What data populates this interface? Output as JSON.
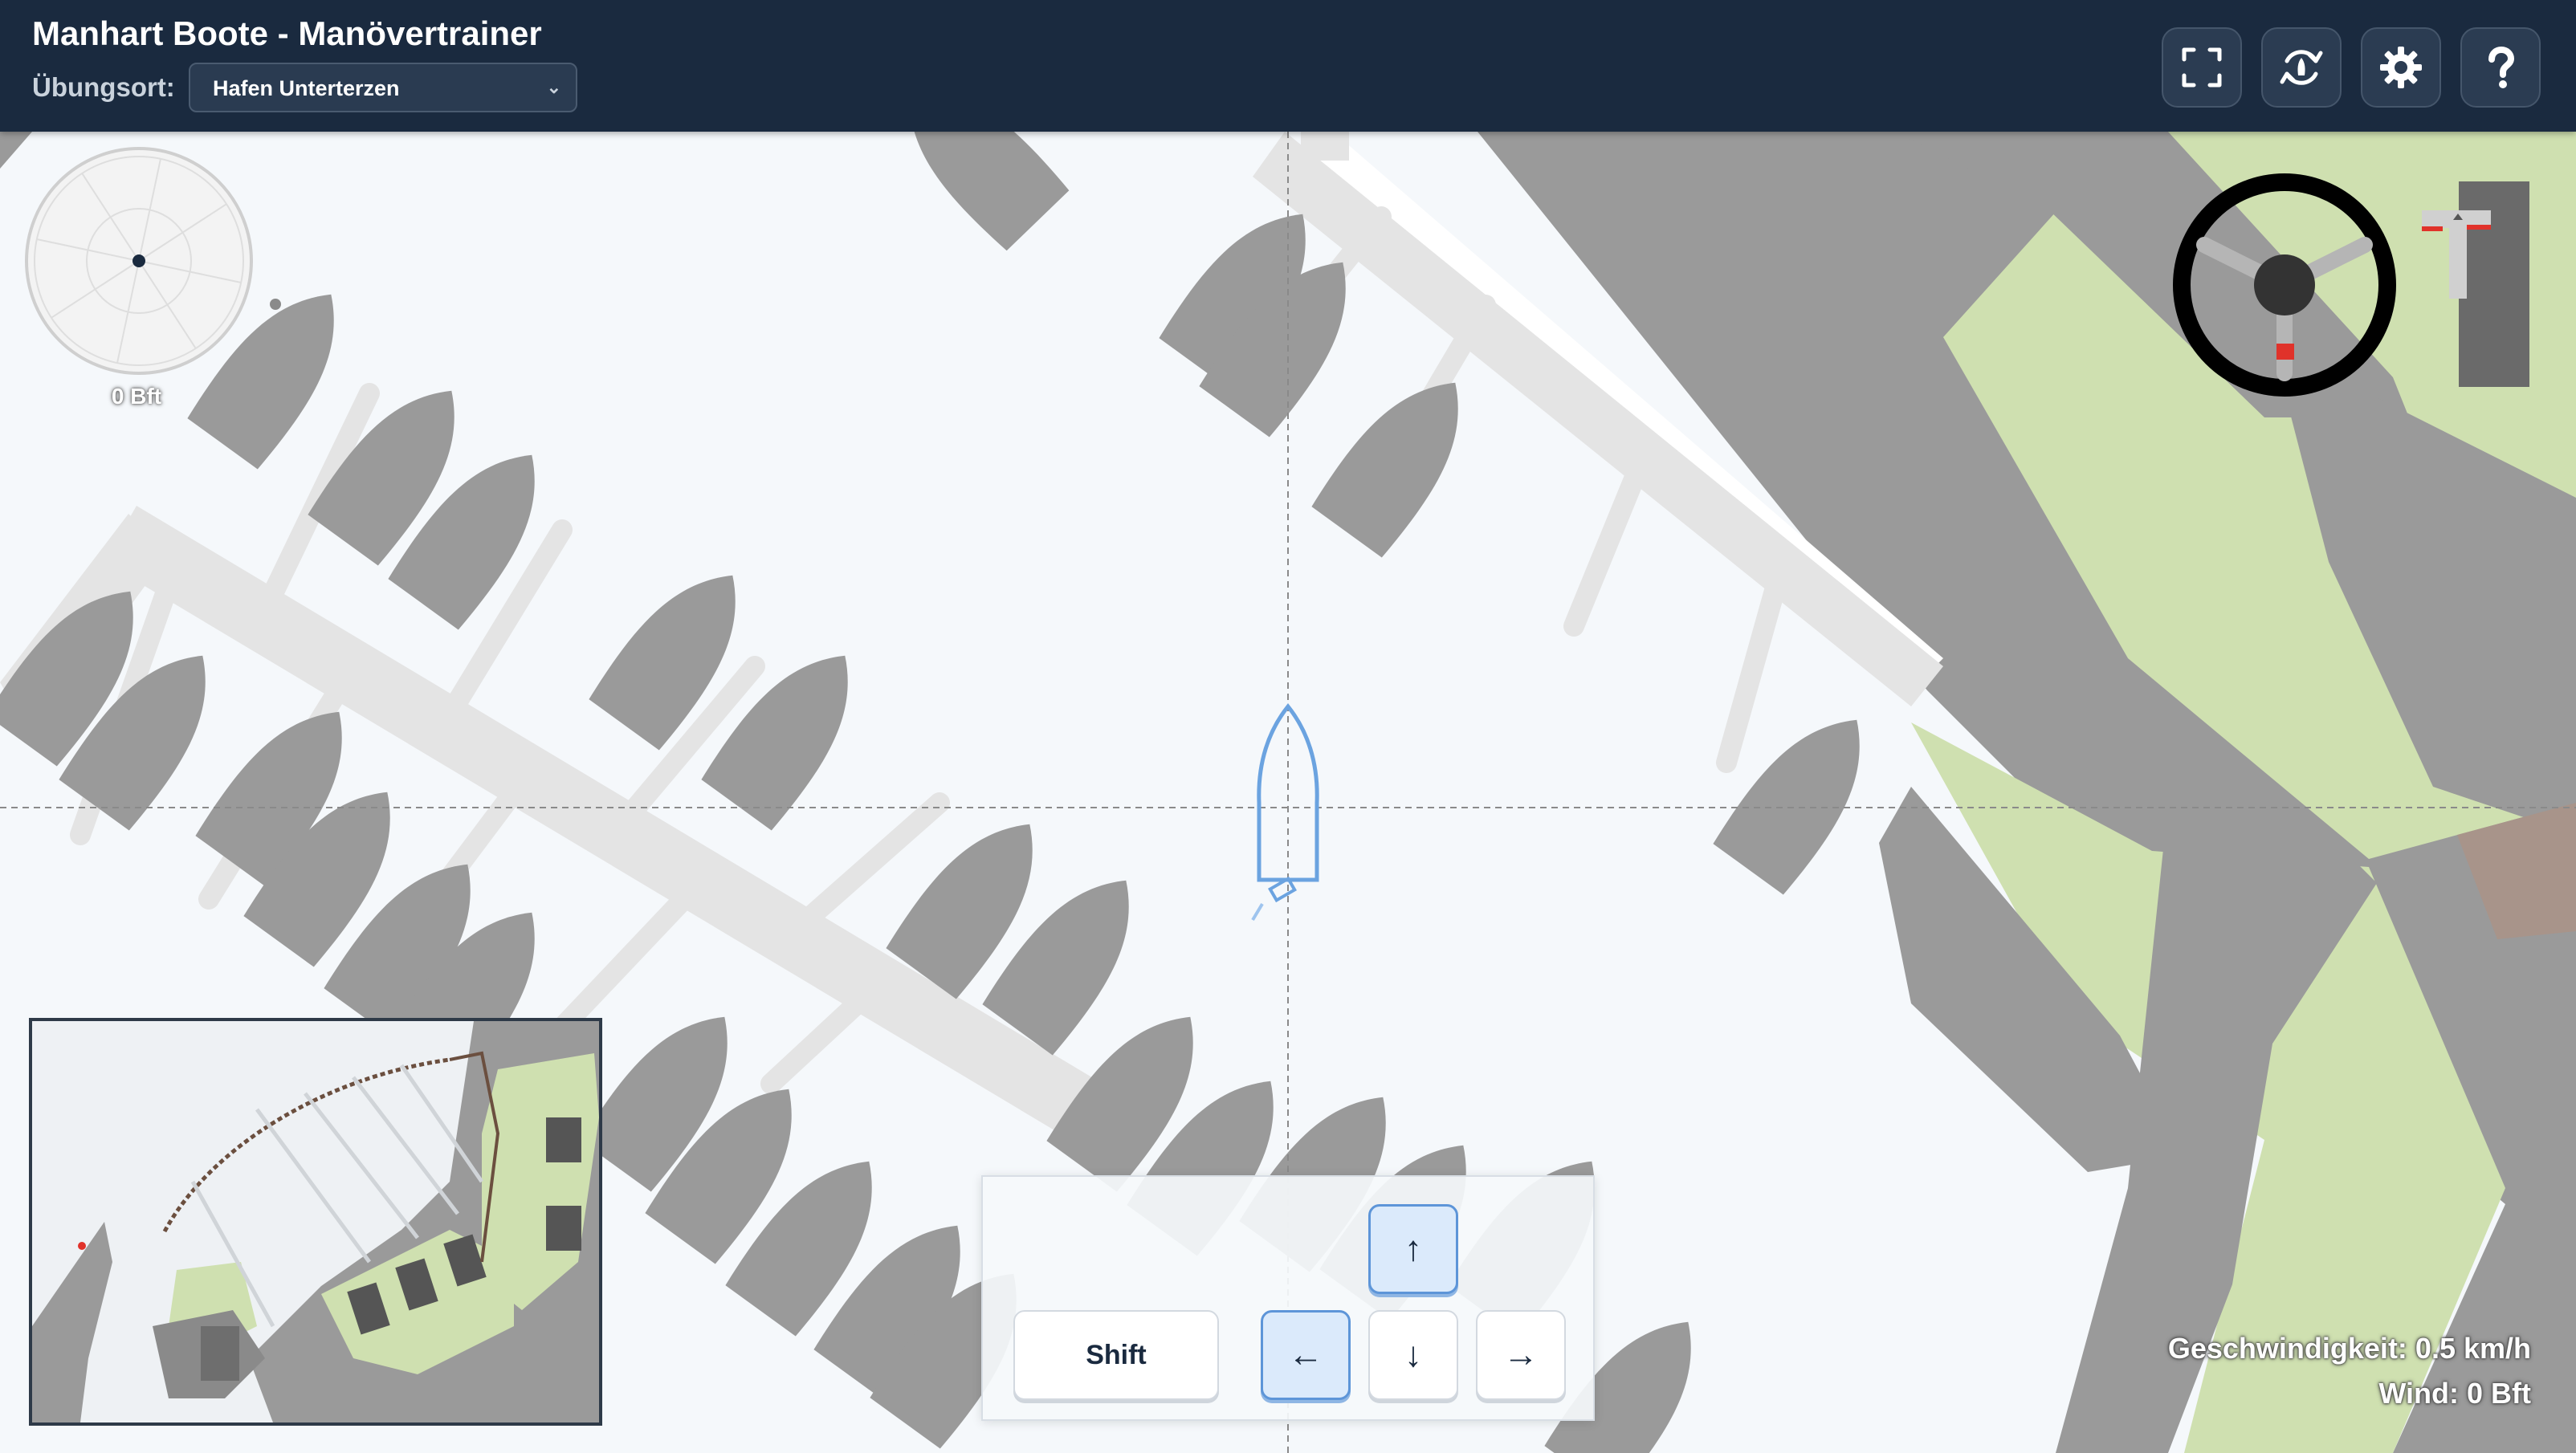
{
  "app": {
    "title": "Manhart Boote - Manövertrainer"
  },
  "location": {
    "label": "Übungsort:",
    "selected": "Hafen Unterterzen"
  },
  "toolbar": {
    "buttons": [
      {
        "name": "fullscreen",
        "icon": "fullscreen-icon"
      },
      {
        "name": "reset-boat",
        "icon": "reset-boat-icon"
      },
      {
        "name": "settings",
        "icon": "gear-icon"
      },
      {
        "name": "help",
        "icon": "help-icon"
      }
    ]
  },
  "wind": {
    "beaufort_label": "0 Bft"
  },
  "keypad": {
    "shift_label": "Shift",
    "keys": {
      "up": "↑",
      "left": "←",
      "down": "↓",
      "right": "→"
    },
    "active_keys": [
      "up",
      "left"
    ]
  },
  "status": {
    "speed": "Geschwindigkeit: 0.5 km/h",
    "wind": "Wind: 0 Bft"
  },
  "colors": {
    "header_bg": "#1a2a3f",
    "water": "#f5f8fb",
    "boats": "#9a9a9a",
    "jetty": "#e4e4e4",
    "land_green": "#cfe0b0",
    "own_boat": "#6ba3e0",
    "rudder_marker": "#e0322a"
  }
}
